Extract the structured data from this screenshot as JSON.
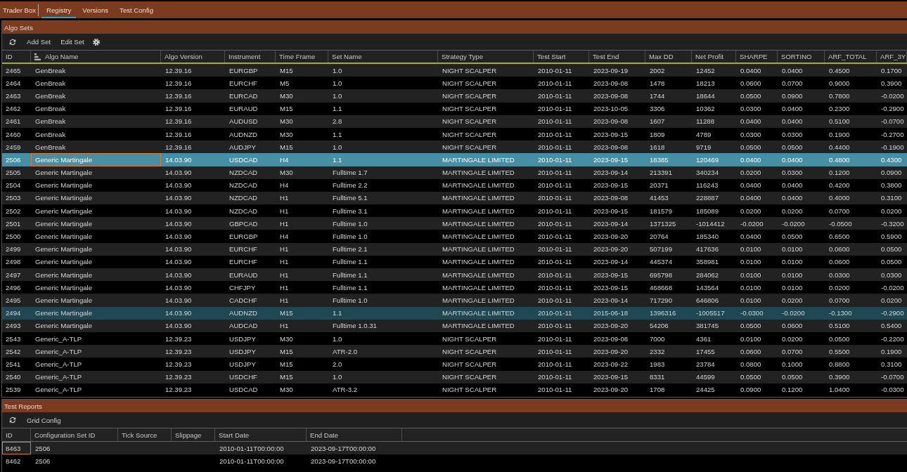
{
  "app_title": "Trader Box",
  "tabs": [
    {
      "label": "Registry",
      "selected": true
    },
    {
      "label": "Versions",
      "selected": false
    },
    {
      "label": "Test Config",
      "selected": false
    }
  ],
  "algo_sets": {
    "title": "Algo Sets",
    "toolbar": [
      {
        "kind": "refresh"
      },
      {
        "kind": "button",
        "label": "Add Set"
      },
      {
        "kind": "button",
        "label": "Edit Set"
      },
      {
        "kind": "settings"
      }
    ],
    "table": {
      "columns": [
        {
          "label": "ID",
          "sorted": false
        },
        {
          "label": "Algo Name",
          "sorted": true
        },
        {
          "label": "Algo Version",
          "sorted": false
        },
        {
          "label": "Instrument",
          "sorted": false
        },
        {
          "label": "Time Frame",
          "sorted": false
        },
        {
          "label": "Set Name",
          "sorted": false
        },
        {
          "label": "Strategy Type",
          "sorted": false
        },
        {
          "label": "Test Start",
          "sorted": false
        },
        {
          "label": "Test End",
          "sorted": false
        },
        {
          "label": "Max DD",
          "sorted": false
        },
        {
          "label": "Net Profit",
          "sorted": false
        },
        {
          "label": "SHARPE",
          "sorted": false
        },
        {
          "label": "SORTINO",
          "sorted": false
        },
        {
          "label": "ARF_TOTAL",
          "sorted": false
        },
        {
          "label": "ARF_3Y",
          "sorted": false
        }
      ],
      "rows": [
        {
          "selected": false,
          "hovered": false,
          "cells": [
            "2465",
            "GenBreak",
            "12.39.16",
            "EURGBP",
            "M15",
            "1.0",
            "NIGHT SCALPER",
            "2010-01-11",
            "2023-09-19",
            "2002",
            "12452",
            "0.0400",
            "0.0400",
            "0.4500",
            "0.1700"
          ]
        },
        {
          "selected": false,
          "hovered": false,
          "cells": [
            "2464",
            "GenBreak",
            "12.39.16",
            "EURCHF",
            "M5",
            "1.0",
            "NIGHT SCALPER",
            "2010-01-11",
            "2023-09-08",
            "1478",
            "18213",
            "0.0600",
            "0.0700",
            "0.9000",
            "0.3900"
          ]
        },
        {
          "selected": false,
          "hovered": false,
          "cells": [
            "2463",
            "GenBreak",
            "12.39.16",
            "EURCAD",
            "M30",
            "1.0",
            "NIGHT SCALPER",
            "2010-01-11",
            "2023-09-08",
            "1744",
            "18644",
            "0.0500",
            "0.0900",
            "0.7800",
            "-0.0200"
          ]
        },
        {
          "selected": false,
          "hovered": false,
          "cells": [
            "2462",
            "GenBreak",
            "12.39.16",
            "EURAUD",
            "M15",
            "1.1",
            "NIGHT SCALPER",
            "2010-01-11",
            "2023-10-05",
            "3306",
            "10362",
            "0.0300",
            "0.0400",
            "0.2300",
            "-0.2900"
          ]
        },
        {
          "selected": false,
          "hovered": false,
          "cells": [
            "2461",
            "GenBreak",
            "12.39.16",
            "AUDUSD",
            "M30",
            "2.8",
            "NIGHT SCALPER",
            "2010-01-11",
            "2023-09-08",
            "1607",
            "11288",
            "0.0400",
            "0.0400",
            "0.5100",
            "-0.0700"
          ]
        },
        {
          "selected": false,
          "hovered": false,
          "cells": [
            "2460",
            "GenBreak",
            "12.39.16",
            "AUDNZD",
            "M30",
            "1.1",
            "NIGHT SCALPER",
            "2010-01-11",
            "2023-09-15",
            "1809",
            "4789",
            "0.0300",
            "0.0300",
            "0.1900",
            "-0.2700"
          ]
        },
        {
          "selected": false,
          "hovered": false,
          "cells": [
            "2459",
            "GenBreak",
            "12.39.16",
            "AUDJPY",
            "M15",
            "1.0",
            "NIGHT SCALPER",
            "2010-01-11",
            "2023-09-08",
            "1618",
            "9719",
            "0.0500",
            "0.0500",
            "0.4400",
            "-0.1900"
          ]
        },
        {
          "selected": true,
          "hovered": false,
          "cells": [
            "2506",
            {
              "text": "Generic Martingale",
              "focused": true
            },
            "14.03.90",
            "USDCAD",
            "H4",
            "1.1",
            "MARTINGALE LIMITED",
            "2010-01-11",
            "2023-09-15",
            "18385",
            "120469",
            "0.0400",
            "0.0400",
            "0.4800",
            "0.4300"
          ]
        },
        {
          "selected": false,
          "hovered": false,
          "cells": [
            "2505",
            "Generic Martingale",
            "14.03.90",
            "NZDCAD",
            "M30",
            "Fulltime 1.7",
            "MARTINGALE LIMITED",
            "2010-01-11",
            "2023-09-14",
            "213391",
            "340234",
            "0.0200",
            "0.0300",
            "0.1200",
            "0.0900"
          ]
        },
        {
          "selected": false,
          "hovered": false,
          "cells": [
            "2504",
            "Generic Martingale",
            "14.03.90",
            "NZDCAD",
            "H4",
            "Fulltime 2.2",
            "MARTINGALE LIMITED",
            "2010-01-11",
            "2023-09-15",
            "20371",
            "116243",
            "0.0400",
            "0.0400",
            "0.4200",
            "0.3800"
          ]
        },
        {
          "selected": false,
          "hovered": false,
          "cells": [
            "2503",
            "Generic Martingale",
            "14.03.90",
            "NZDCAD",
            "H1",
            "Fulltime 5.1",
            "MARTINGALE LIMITED",
            "2010-01-11",
            "2023-09-08",
            "41453",
            "228887",
            "0.0400",
            "0.0400",
            "0.4000",
            "0.3100"
          ]
        },
        {
          "selected": false,
          "hovered": false,
          "cells": [
            "2502",
            "Generic Martingale",
            "14.03.90",
            "NZDCAD",
            "H1",
            "Fulltime 3.1",
            "MARTINGALE LIMITED",
            "2010-01-11",
            "2023-09-15",
            "181579",
            "185089",
            "0.0200",
            "0.0200",
            "0.0700",
            "0.0200"
          ]
        },
        {
          "selected": false,
          "hovered": false,
          "cells": [
            "2501",
            "Generic Martingale",
            "14.03.90",
            "GBPCAD",
            "H1",
            "Fulltime 1.0",
            "MARTINGALE LIMITED",
            "2010-01-11",
            "2023-09-14",
            "1371325",
            "-1014412",
            "-0.0200",
            "-0.0200",
            "-0.0500",
            "-0.3200"
          ]
        },
        {
          "selected": false,
          "hovered": false,
          "cells": [
            "2500",
            "Generic Martingale",
            "14.03.90",
            "EURGBP",
            "H4",
            "Fulltime 1.0",
            "MARTINGALE LIMITED",
            "2010-01-11",
            "2023-09-20",
            "20764",
            "185340",
            "0.0400",
            "0.0500",
            "0.6500",
            "0.5900"
          ]
        },
        {
          "selected": false,
          "hovered": false,
          "cells": [
            "2499",
            "Generic Martingale",
            "14.03.90",
            "EURCHF",
            "H1",
            "Fulltime 2.1",
            "MARTINGALE LIMITED",
            "2010-01-11",
            "2023-09-20",
            "507199",
            "417636",
            "0.0100",
            "0.0100",
            "0.0600",
            "0.0500"
          ]
        },
        {
          "selected": false,
          "hovered": false,
          "cells": [
            "2498",
            "Generic Martingale",
            "14.03.90",
            "EURCHF",
            "H1",
            "Fulltime 1.1",
            "MARTINGALE LIMITED",
            "2010-01-11",
            "2023-09-14",
            "445374",
            "358981",
            "0.0100",
            "0.0100",
            "0.0600",
            "0.0500"
          ]
        },
        {
          "selected": false,
          "hovered": false,
          "cells": [
            "2497",
            "Generic Martingale",
            "14.03.90",
            "EURAUD",
            "H1",
            "Fulltime 1.1",
            "MARTINGALE LIMITED",
            "2010-01-11",
            "2023-09-15",
            "695798",
            "284062",
            "0.0100",
            "0.0100",
            "0.0300",
            "0.0300"
          ]
        },
        {
          "selected": false,
          "hovered": false,
          "cells": [
            "2496",
            "Generic Martingale",
            "14.03.90",
            "CHFJPY",
            "H1",
            "Fulltime 1.1",
            "MARTINGALE LIMITED",
            "2010-01-11",
            "2023-09-15",
            "468668",
            "143564",
            "0.0100",
            "0.0100",
            "0.0200",
            "-0.0200"
          ]
        },
        {
          "selected": false,
          "hovered": false,
          "cells": [
            "2495",
            "Generic Martingale",
            "14.03.90",
            "CADCHF",
            "H1",
            "Fulltime 1.0",
            "MARTINGALE LIMITED",
            "2010-01-11",
            "2023-09-14",
            "717290",
            "646806",
            "0.0100",
            "0.0200",
            "0.0700",
            "0.0200"
          ]
        },
        {
          "selected": false,
          "hovered": true,
          "cells": [
            "2494",
            "Generic Martingale",
            "14.03.90",
            "AUDNZD",
            "M15",
            "1.1",
            "MARTINGALE LIMITED",
            "2010-01-11",
            "2015-06-18",
            "1396316",
            "-1005517",
            "-0.0300",
            "-0.0200",
            "-0.1300",
            "-0.2900"
          ]
        },
        {
          "selected": false,
          "hovered": false,
          "cells": [
            "2493",
            "Generic Martingale",
            "14.03.90",
            "AUDCAD",
            "H1",
            "Fulltime 1.0.31",
            "MARTINGALE LIMITED",
            "2010-01-11",
            "2023-09-20",
            "54206",
            "381745",
            "0.0500",
            "0.0600",
            "0.5100",
            "0.5400"
          ]
        },
        {
          "selected": false,
          "hovered": false,
          "cells": [
            "2543",
            "Generic_A-TLP",
            "12.39.23",
            "USDJPY",
            "M30",
            "1.0",
            "NIGHT SCALPER",
            "2010-01-11",
            "2023-09-08",
            "7000",
            "4361",
            "0.0100",
            "0.0200",
            "0.0500",
            "-0.2200"
          ]
        },
        {
          "selected": false,
          "hovered": false,
          "cells": [
            "2542",
            "Generic_A-TLP",
            "12.39.23",
            "USDJPY",
            "M15",
            "ATR-2.0",
            "NIGHT SCALPER",
            "2010-01-11",
            "2023-09-20",
            "2332",
            "17455",
            "0.0600",
            "0.0700",
            "0.5500",
            "0.1900"
          ]
        },
        {
          "selected": false,
          "hovered": false,
          "cells": [
            "2541",
            "Generic_A-TLP",
            "12.39.23",
            "USDJPY",
            "M15",
            "2.0",
            "NIGHT SCALPER",
            "2010-01-11",
            "2023-09-22",
            "1983",
            "23784",
            "0.0800",
            "0.1000",
            "0.8800",
            "0.3100"
          ]
        },
        {
          "selected": false,
          "hovered": false,
          "cells": [
            "2540",
            "Generic_A-TLP",
            "12.39.23",
            "USDCHF",
            "M15",
            "1.0",
            "NIGHT SCALPER",
            "2010-01-11",
            "2023-09-15",
            "8331",
            "44599",
            "0.0500",
            "0.0500",
            "0.3900",
            "-0.0700"
          ]
        },
        {
          "selected": false,
          "hovered": false,
          "cells": [
            "2539",
            "Generic_A-TLP",
            "12.39.23",
            "USDCAD",
            "M30",
            "ATR-3.2",
            "NIGHT SCALPER",
            "2010-01-11",
            "2023-09-20",
            "1708",
            "24425",
            "0.0900",
            "0.1200",
            "1.0400",
            "-0.0300"
          ]
        }
      ]
    }
  },
  "test_reports": {
    "title": "Test Reports",
    "toolbar": [
      {
        "kind": "refresh"
      },
      {
        "kind": "button",
        "label": "Grid Config"
      }
    ],
    "table": {
      "columns": [
        {
          "label": "ID",
          "sorted": false
        },
        {
          "label": "Configuration Set ID",
          "sorted": false
        },
        {
          "label": "Tick Source",
          "sorted": false
        },
        {
          "label": "Slippage",
          "sorted": false
        },
        {
          "label": "Start Date",
          "sorted": false
        },
        {
          "label": "End Date",
          "sorted": false
        }
      ],
      "rows": [
        {
          "cells": [
            {
              "text": "8463",
              "focused": true
            },
            "2506",
            null,
            null,
            "2010-01-11T00:00:00",
            "2023-09-17T00:00:00"
          ]
        },
        {
          "cells": [
            "8462",
            "2506",
            null,
            null,
            "2010-01-11T00:00:00",
            "2023-09-17T00:00:00"
          ]
        }
      ]
    }
  }
}
